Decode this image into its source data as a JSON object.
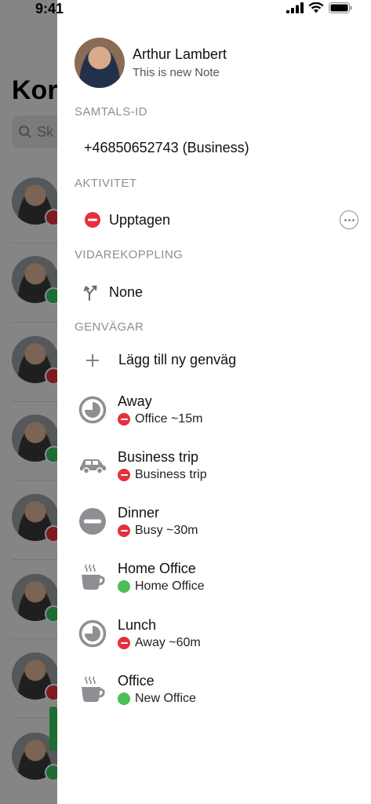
{
  "status_bar": {
    "time": "9:41"
  },
  "background": {
    "title_partial": "Kor",
    "search_partial": "Sk",
    "contact_statuses": [
      "busy",
      "available",
      "busy-call",
      "available",
      "busy",
      "available",
      "busy",
      "available"
    ]
  },
  "profile": {
    "name": "Arthur Lambert",
    "note": "This is new Note"
  },
  "call_id": {
    "header": "SAMTALS-ID",
    "value": "+46850652743 (Business)"
  },
  "activity": {
    "header": "AKTIVITET",
    "value": "Upptagen"
  },
  "forwarding": {
    "header": "VIDAREKOPPLING",
    "value": "None"
  },
  "shortcuts": {
    "header": "GENVÄGAR",
    "add_label": "Lägg till ny genväg",
    "items": [
      {
        "title": "Away",
        "subtitle": "Office ~15m",
        "icon": "clock-icon",
        "status": "red"
      },
      {
        "title": "Business trip",
        "subtitle": "Business trip",
        "icon": "car-icon",
        "status": "red"
      },
      {
        "title": "Dinner",
        "subtitle": "Busy ~30m",
        "icon": "busy-icon",
        "status": "red"
      },
      {
        "title": "Home Office",
        "subtitle": "Home Office",
        "icon": "coffee-icon",
        "status": "green"
      },
      {
        "title": "Lunch",
        "subtitle": "Away ~60m",
        "icon": "clock-icon",
        "status": "red"
      },
      {
        "title": "Office",
        "subtitle": "New Office",
        "icon": "coffee-icon",
        "status": "green"
      }
    ]
  },
  "colors": {
    "busy_red": "#e5303b",
    "available_green": "#4cbe5a",
    "section_gray": "#8e8e93"
  }
}
